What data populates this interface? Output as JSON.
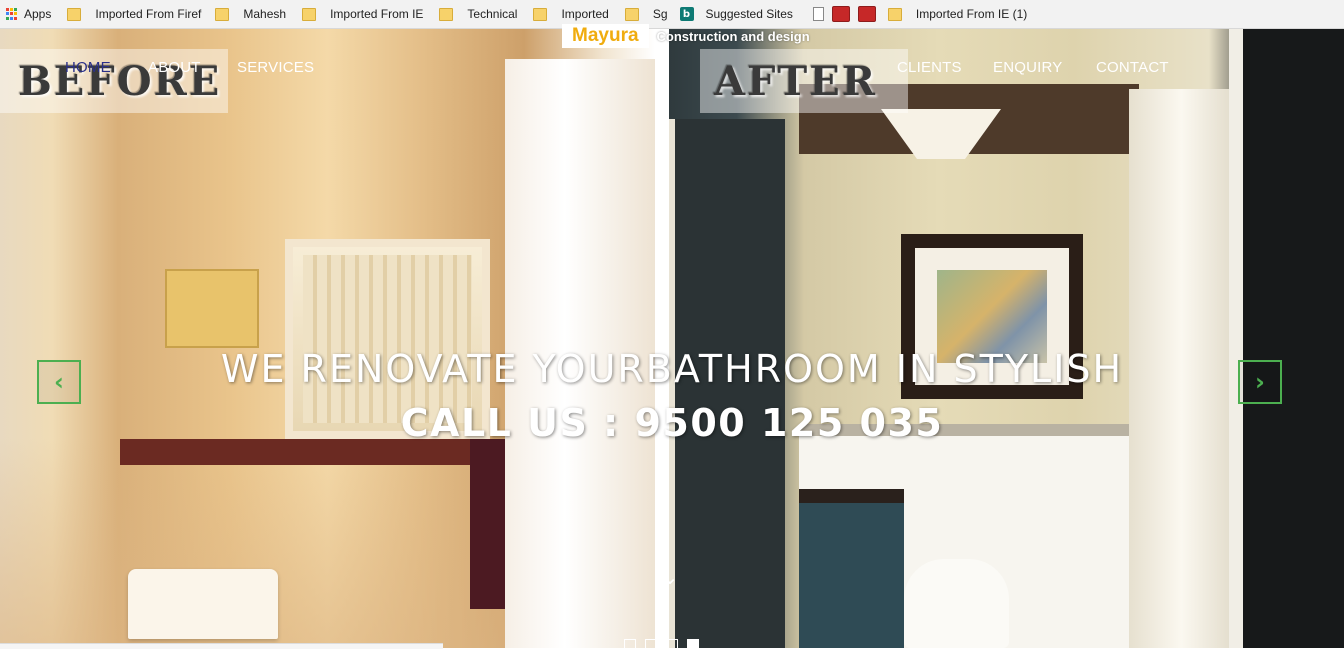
{
  "bookmarks": [
    {
      "label": "Apps",
      "icon": "apps-grid-icon"
    },
    {
      "label": "Imported From Firef",
      "icon": "folder-icon"
    },
    {
      "label": "Mahesh",
      "icon": "folder-icon"
    },
    {
      "label": "Imported From IE",
      "icon": "folder-icon"
    },
    {
      "label": "Technical",
      "icon": "folder-icon"
    },
    {
      "label": "Imported",
      "icon": "folder-icon"
    },
    {
      "label": "Sg",
      "icon": "folder-icon"
    },
    {
      "label": "Suggested Sites",
      "icon": "bing-icon"
    },
    {
      "label": "",
      "icon": "page-icon"
    },
    {
      "label": "",
      "icon": "red-site-icon"
    },
    {
      "label": "",
      "icon": "red-site-icon"
    },
    {
      "label": "Imported From IE (1)",
      "icon": "folder-icon"
    }
  ],
  "hero": {
    "before_label": "BEFORE",
    "after_label": "AFTER",
    "headline": "WE RENOVATE YOURBATHROOM IN STYLISH",
    "call_text": "CALL US : 9500 125 035",
    "scroll_symbol": "⌄",
    "prev_symbol": "‹",
    "next_symbol": "›",
    "slides_total": 4,
    "active_slide": 4
  },
  "nav": {
    "home": "HOME",
    "about": "ABOUT",
    "services": "SERVICES",
    "clients": "CLIENTS",
    "enquiry": "ENQUIRY",
    "contact": "CONTACT"
  },
  "brand": {
    "logo": "Mayura",
    "tagline": "Construction and design"
  },
  "colors": {
    "brand_gold": "#f0ac0e",
    "active_nav": "#2a2f88",
    "arrow_green": "#4caf50"
  }
}
